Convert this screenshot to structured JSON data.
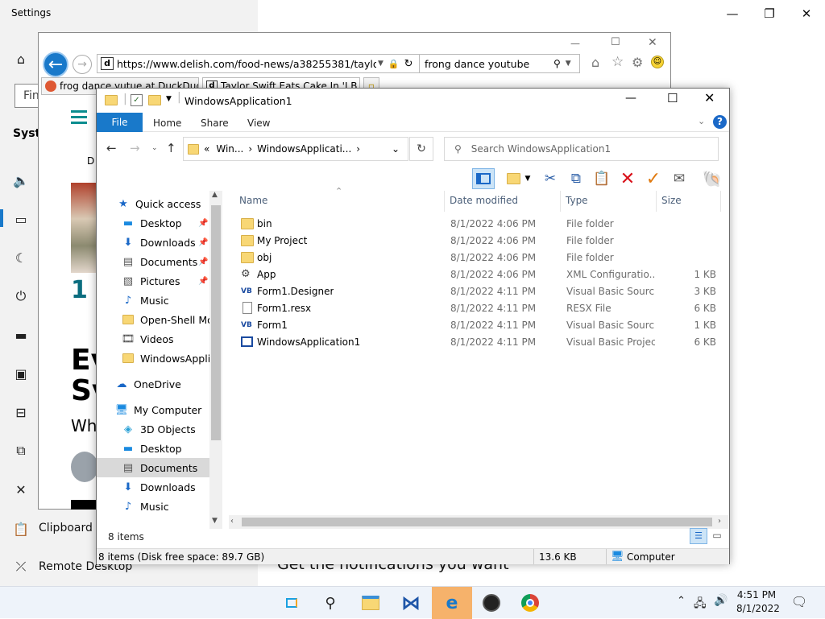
{
  "settings": {
    "title": "Settings",
    "search_placeholder": "Fin",
    "section_label": "Syste",
    "nav_clipboard": "Clipboard",
    "nav_remote_desktop": "Remote Desktop",
    "bottom_text": "Get the notifications you want",
    "icons": [
      "home-icon",
      "sound-icon",
      "notifications-icon",
      "focus-assist-icon",
      "power-icon",
      "battery-icon",
      "storage-icon",
      "tablet-icon",
      "multitasking-icon",
      "projecting-icon",
      "shared-experiences-icon",
      "clipboard-icon",
      "remote-desktop-icon"
    ]
  },
  "ie": {
    "url": "https://www.delish.com/food-news/a38255381/taylor-swift",
    "search_text": "frong dance youtube",
    "tabs": [
      {
        "label": "frog dance yutue at DuckDuck"
      },
      {
        "label": "Taylor Swift Eats Cake In 'I B"
      }
    ],
    "page_headline_1": "Ev",
    "page_headline_2": "Sv",
    "page_subtext": "Wh",
    "page_number": "1",
    "page_letter": "D"
  },
  "explorer": {
    "title": "WindowsApplication1",
    "ribbon_tabs": {
      "file": "File",
      "home": "Home",
      "share": "Share",
      "view": "View"
    },
    "breadcrumb": {
      "prefix": "«",
      "part1": "Win...",
      "part2": "WindowsApplicati..."
    },
    "search_placeholder": "Search WindowsApplication1",
    "columns": {
      "name": "Name",
      "date": "Date modified",
      "type": "Type",
      "size": "Size"
    },
    "nav_items": [
      {
        "label": "Quick access",
        "icon": "star-icon"
      },
      {
        "label": "Desktop",
        "icon": "desktop-icon",
        "pinned": true
      },
      {
        "label": "Downloads",
        "icon": "downloads-icon",
        "pinned": true
      },
      {
        "label": "Documents",
        "icon": "documents-icon",
        "pinned": true
      },
      {
        "label": "Pictures",
        "icon": "pictures-icon",
        "pinned": true
      },
      {
        "label": "Music",
        "icon": "music-icon"
      },
      {
        "label": "Open-Shell Mod",
        "icon": "folder-icon"
      },
      {
        "label": "Videos",
        "icon": "videos-icon"
      },
      {
        "label": "WindowsApplica",
        "icon": "folder-icon"
      },
      {
        "label": "OneDrive",
        "icon": "onedrive-icon"
      },
      {
        "label": "My Computer",
        "icon": "computer-icon"
      },
      {
        "label": "3D Objects",
        "icon": "3d-objects-icon"
      },
      {
        "label": "Desktop",
        "icon": "desktop-icon"
      },
      {
        "label": "Documents",
        "icon": "documents-icon",
        "selected": true
      },
      {
        "label": "Downloads",
        "icon": "downloads-icon"
      },
      {
        "label": "Music",
        "icon": "music-icon"
      }
    ],
    "files": [
      {
        "name": "bin",
        "date": "8/1/2022 4:06 PM",
        "type": "File folder",
        "size": "",
        "icon": "folder"
      },
      {
        "name": "My Project",
        "date": "8/1/2022 4:06 PM",
        "type": "File folder",
        "size": "",
        "icon": "folder"
      },
      {
        "name": "obj",
        "date": "8/1/2022 4:06 PM",
        "type": "File folder",
        "size": "",
        "icon": "folder"
      },
      {
        "name": "App",
        "date": "8/1/2022 4:06 PM",
        "type": "XML Configuratio...",
        "size": "1 KB",
        "icon": "config"
      },
      {
        "name": "Form1.Designer",
        "date": "8/1/2022 4:11 PM",
        "type": "Visual Basic Sourc...",
        "size": "3 KB",
        "icon": "vb"
      },
      {
        "name": "Form1.resx",
        "date": "8/1/2022 4:11 PM",
        "type": "RESX File",
        "size": "6 KB",
        "icon": "file"
      },
      {
        "name": "Form1",
        "date": "8/1/2022 4:11 PM",
        "type": "Visual Basic Sourc...",
        "size": "1 KB",
        "icon": "vb"
      },
      {
        "name": "WindowsApplication1",
        "date": "8/1/2022 4:11 PM",
        "type": "Visual Basic Projec...",
        "size": "6 KB",
        "icon": "project"
      }
    ],
    "item_count": "8 items",
    "status_left": "8 items (Disk free space: 89.7 GB)",
    "status_size": "13.6 KB",
    "status_location": "Computer",
    "vb_badge": "VB"
  },
  "taskbar": {
    "time": "4:51 PM",
    "date": "8/1/2022",
    "apps": [
      "task-view-icon",
      "search-icon",
      "file-explorer-icon",
      "visual-studio-icon",
      "internet-explorer-icon",
      "obs-icon",
      "chrome-icon"
    ]
  },
  "colors": {
    "accent": "#1979ca",
    "delete_red": "#d9121b",
    "check_orange": "#e07a10",
    "header_text": "#4c607a"
  }
}
